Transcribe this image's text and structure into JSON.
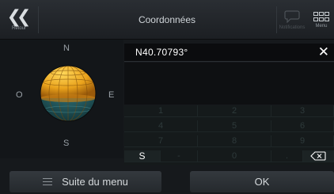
{
  "header": {
    "back_label": "Retour",
    "title": "Coordonnées",
    "notifications_label": "Notifications",
    "menu_label": "Menu"
  },
  "compass": {
    "north": "N",
    "south": "S",
    "east": "E",
    "west": "O"
  },
  "input": {
    "value": "N40.70793°"
  },
  "keypad": {
    "rows": [
      [
        "1",
        "2",
        "3"
      ],
      [
        "4",
        "5",
        "6"
      ],
      [
        "7",
        "8",
        "9"
      ],
      [
        "S",
        "-",
        "0",
        ".",
        ""
      ]
    ],
    "hemisphere_key": "S"
  },
  "footer": {
    "more_label": "Suite du menu",
    "ok_label": "OK"
  },
  "colors": {
    "globe": "#f0b428",
    "background": "#16191c",
    "accent_text": "#ffffff"
  }
}
